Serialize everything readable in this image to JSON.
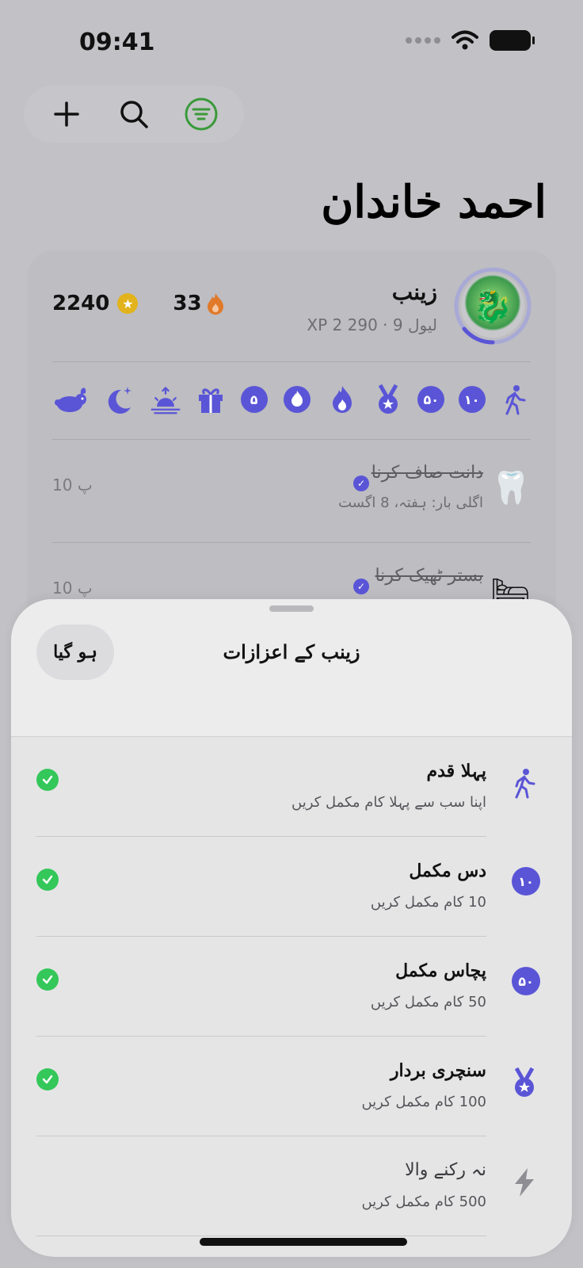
{
  "status_bar": {
    "time": "09:41"
  },
  "toolbar": {
    "add_icon": "plus-icon",
    "search_icon": "search-icon",
    "filter_icon": "filter-icon",
    "accent": "#3a9a3a"
  },
  "page_title": "احمد خاندان",
  "member": {
    "name": "زینب",
    "meta": "لیول 9 · 290 2 XP",
    "coins": "2240",
    "streak": "33",
    "badges": [
      "walk",
      "۱۰",
      "۵۰",
      "medal",
      "flame",
      "flame-circle",
      "۵",
      "gift",
      "sunrise",
      "moon",
      "rabbit"
    ]
  },
  "tasks": [
    {
      "emoji": "🦷",
      "title": "دانت صاف کرنا",
      "subtitle": "اگلی بار: ہفتہ، 8 اگست",
      "points": "10 پ"
    },
    {
      "emoji": "🛏",
      "title": "بستر ٹھیک کرنا",
      "subtitle": "",
      "points": "10 پ"
    }
  ],
  "sheet": {
    "title": "زینب کے اعزازات",
    "done_label": "ہو گیا",
    "achievements": [
      {
        "icon": "walk-icon",
        "badge_text": "",
        "title": "پہلا قدم",
        "desc": "اپنا سب سے پہلا کام مکمل کریں",
        "earned": true
      },
      {
        "icon": "ten-badge-icon",
        "badge_text": "۱۰",
        "title": "دس مکمل",
        "desc": "10 کام مکمل کریں",
        "earned": true
      },
      {
        "icon": "fifty-badge-icon",
        "badge_text": "۵۰",
        "title": "پچاس مکمل",
        "desc": "50 کام مکمل کریں",
        "earned": true
      },
      {
        "icon": "medal-icon",
        "badge_text": "",
        "title": "سنچری بردار",
        "desc": "100 کام مکمل کریں",
        "earned": true
      },
      {
        "icon": "bolt-icon",
        "badge_text": "",
        "title": "نہ رکنے والا",
        "desc": "500 کام مکمل کریں",
        "earned": false
      }
    ]
  },
  "colors": {
    "accent": "#5a55d6",
    "success": "#34c759",
    "coin": "#e2b31d",
    "flame": "#e07a2a"
  }
}
